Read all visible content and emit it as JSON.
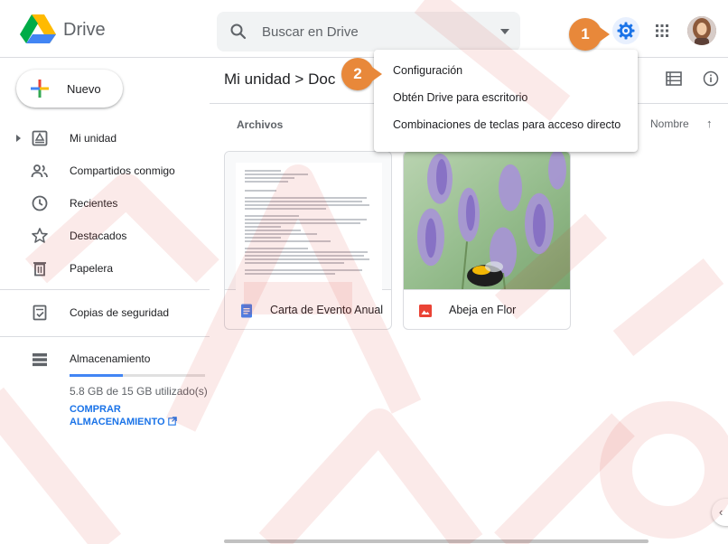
{
  "header": {
    "app_name": "Drive",
    "search_placeholder": "Buscar en Drive"
  },
  "sidebar": {
    "new_label": "Nuevo",
    "items": [
      {
        "label": "Mi unidad",
        "icon": "my-drive-icon"
      },
      {
        "label": "Compartidos conmigo",
        "icon": "shared-icon"
      },
      {
        "label": "Recientes",
        "icon": "clock-icon"
      },
      {
        "label": "Destacados",
        "icon": "star-icon"
      },
      {
        "label": "Papelera",
        "icon": "trash-icon"
      }
    ],
    "backups_label": "Copias de seguridad",
    "storage": {
      "label": "Almacenamiento",
      "used_text": "5.8 GB de 15 GB utilizado(s)",
      "used_fraction": 0.39,
      "buy_label": "COMPRAR ALMACENAMIENTO"
    }
  },
  "main": {
    "breadcrumb": "Mi unidad  >  Doc",
    "section_title": "Archivos",
    "sort_label": "Nombre",
    "files": [
      {
        "name": "Carta de Evento Anual",
        "type": "doc"
      },
      {
        "name": "Abeja en Flor",
        "type": "image"
      }
    ]
  },
  "settings_menu": {
    "items": [
      "Configuración",
      "Obtén Drive para escritorio",
      "Combinaciones de teclas para acceso directo"
    ]
  },
  "callouts": [
    "1",
    "2"
  ],
  "colors": {
    "accent": "#1a73e8",
    "callout": "#e8883a",
    "watermark": "#d93025"
  }
}
